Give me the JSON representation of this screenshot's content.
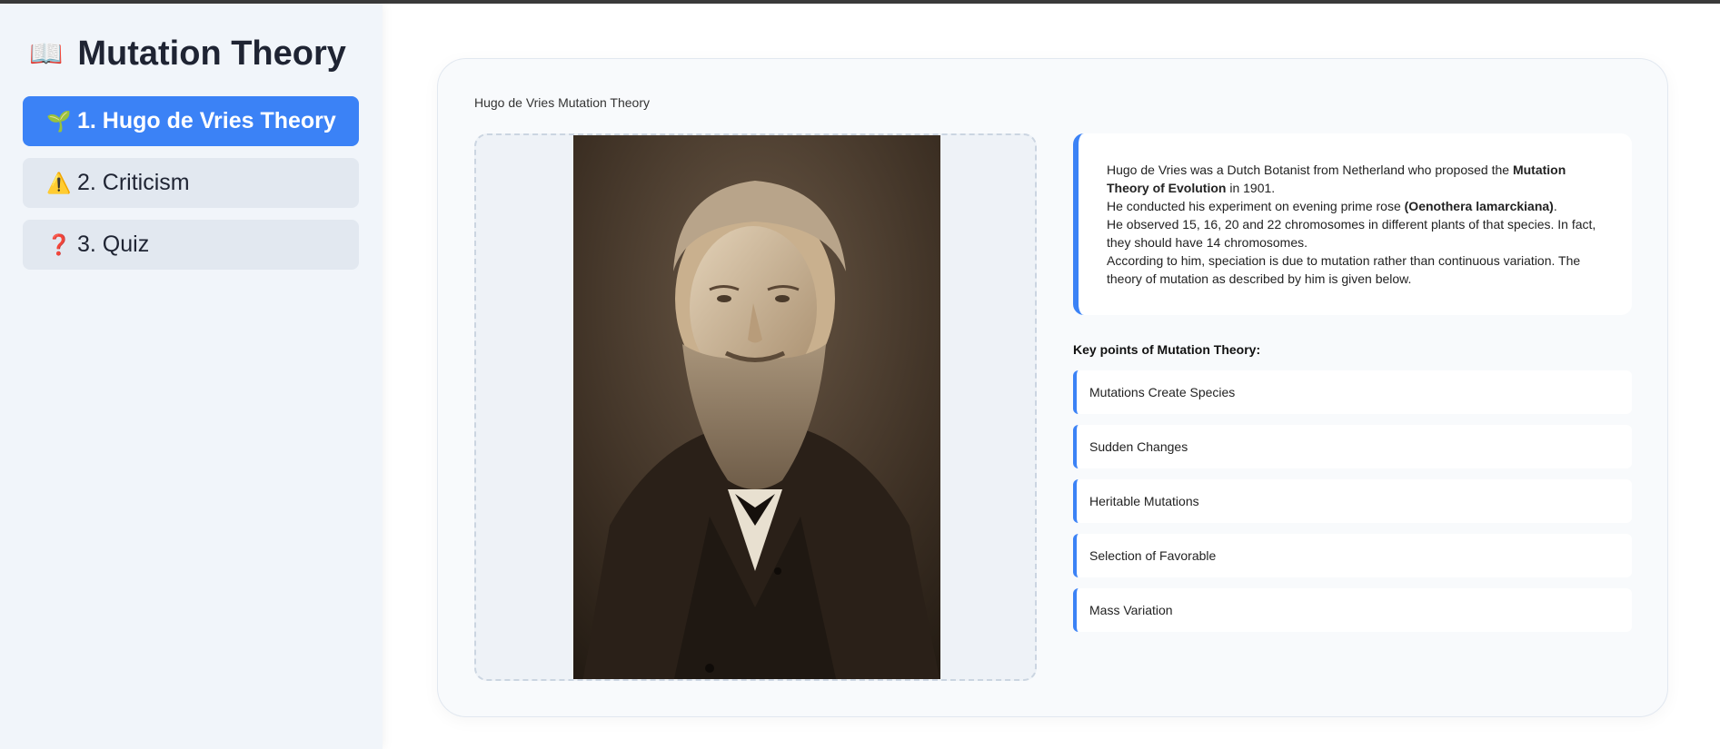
{
  "sidebar": {
    "title": "Mutation Theory",
    "title_icon": "📖",
    "items": [
      {
        "icon": "🌱",
        "label": "1. Hugo de Vries Theory",
        "active": true
      },
      {
        "icon": "⚠️",
        "label": "2. Criticism",
        "active": false
      },
      {
        "icon": "❓",
        "label": "3. Quiz",
        "active": false
      }
    ]
  },
  "main": {
    "card_title": "Hugo de Vries Mutation Theory",
    "intro": {
      "p1_a": "Hugo de Vries was a Dutch Botanist from Netherland who proposed the ",
      "p1_b": "Mutation Theory of Evolution",
      "p1_c": " in 1901.",
      "p2_a": "He conducted his experiment on evening prime rose ",
      "p2_b": "(Oenothera lamarckiana)",
      "p2_c": ".",
      "p3": "He observed 15, 16, 20 and 22 chromosomes in different plants of that species. In fact, they should have 14 chromosomes.",
      "p4": "According to him, speciation is due to mutation rather than continuous variation. The theory of mutation as described by him is given below."
    },
    "key_points_heading": "Key points of Mutation Theory:",
    "key_points": [
      "Mutations Create Species",
      "Sudden Changes",
      "Heritable Mutations",
      "Selection of Favorable",
      "Mass Variation"
    ]
  },
  "colors": {
    "accent": "#3b82f6",
    "sidebar_bg": "#f1f5fa",
    "nav_inactive_bg": "#e2e8f0"
  }
}
